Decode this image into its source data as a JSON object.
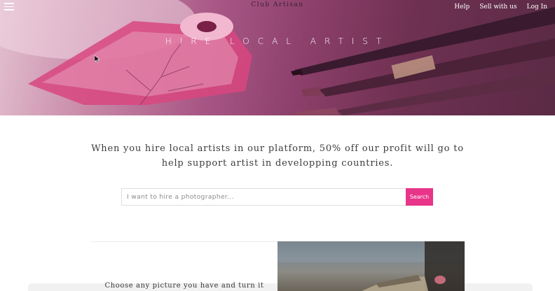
{
  "brand": "Club Artisan",
  "nav": {
    "help": "Help",
    "sell": "Sell with us",
    "login": "Log In"
  },
  "hero": {
    "title": "HIRE LOCAL ARTIST"
  },
  "mission": {
    "line1": "When you hire local artists in our platform, 50% off our profit will go to",
    "line2": "help support artist in developping countries."
  },
  "search": {
    "placeholder": "I want to hire a photographer...",
    "button": "Search"
  },
  "feature": {
    "text": "Choose any picture you have and turn it"
  },
  "colors": {
    "accent": "#e8358a",
    "hero_tint": "#a85785"
  },
  "icons": {
    "menu": "hamburger-menu-icon",
    "cursor": "mouse-pointer-icon"
  }
}
